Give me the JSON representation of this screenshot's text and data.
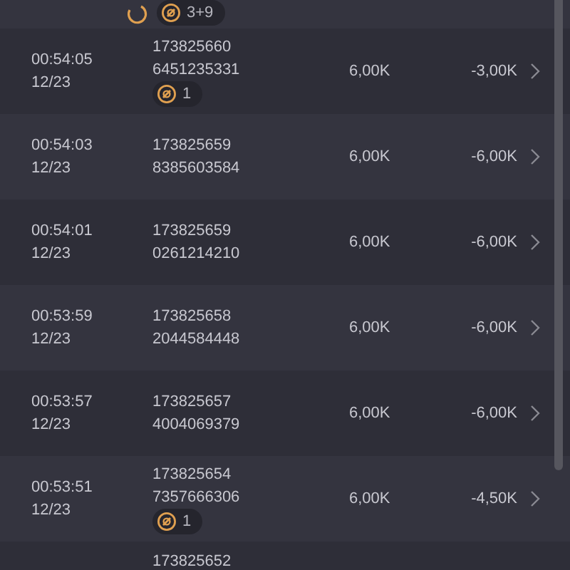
{
  "top_row": {
    "badge": {
      "count": "3+9"
    }
  },
  "rows": [
    {
      "time": "00:54:05",
      "date": "12/23",
      "id_1": "173825660",
      "id_2": "6451235331",
      "badge": {
        "count": "1"
      },
      "amount": "6,00K",
      "result": "-3,00K"
    },
    {
      "time": "00:54:03",
      "date": "12/23",
      "id_1": "173825659",
      "id_2": "8385603584",
      "amount": "6,00K",
      "result": "-6,00K"
    },
    {
      "time": "00:54:01",
      "date": "12/23",
      "id_1": "173825659",
      "id_2": "0261214210",
      "amount": "6,00K",
      "result": "-6,00K"
    },
    {
      "time": "00:53:59",
      "date": "12/23",
      "id_1": "173825658",
      "id_2": "2044584448",
      "amount": "6,00K",
      "result": "-6,00K"
    },
    {
      "time": "00:53:57",
      "date": "12/23",
      "id_1": "173825657",
      "id_2": "4004069379",
      "amount": "6,00K",
      "result": "-6,00K"
    },
    {
      "time": "00:53:51",
      "date": "12/23",
      "id_1": "173825654",
      "id_2": "7357666306",
      "badge": {
        "count": "1"
      },
      "amount": "6,00K",
      "result": "-4,50K"
    }
  ],
  "bottom_row": {
    "id_1": "173825652"
  }
}
